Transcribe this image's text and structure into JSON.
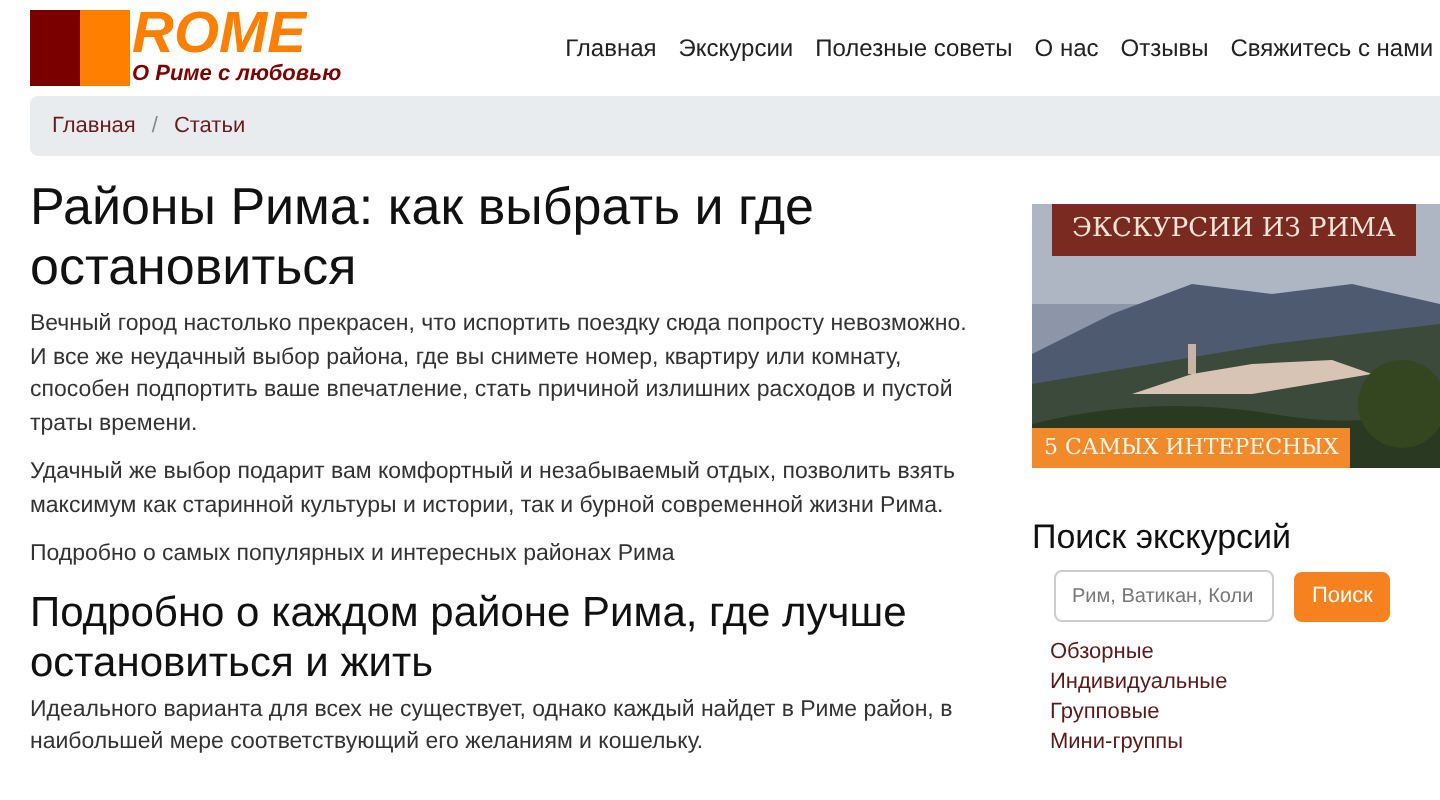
{
  "logo": {
    "title": "ROME",
    "tagline": "О Риме с любовью"
  },
  "nav": [
    "Главная",
    "Экскурсии",
    "Полезные советы",
    "О нас",
    "Отзывы",
    "Свяжитесь с нами"
  ],
  "breadcrumb": [
    "Главная",
    "Статьи"
  ],
  "breadcrumb_separator": "/",
  "article": {
    "title": "Районы Рима: как выбрать и где остановиться",
    "paragraphs": [
      "Вечный город настолько прекрасен, что испортить поездку сюда попросту невозможно. И все же неудачный выбор района, где вы снимете номер, квартиру или комнату, способен подпортить ваше впечатление, стать причиной излишних расходов и пустой траты времени.",
      "Удачный же выбор подарит вам комфортный и незабываемый отдых, позволить  взять максимум как старинной культуры и истории, так и бурной современной жизни Рима.",
      "Подробно о самых популярных и интересных районах Рима"
    ],
    "subtitle": "Подробно о каждом районе Рима, где лучше остановиться и жить",
    "subparagraph": "Идеального варианта для всех не существует, однако каждый найдет в Риме район, в наибольшей мере соответствующий его желаниям и кошельку."
  },
  "banner": {
    "kind": "picture",
    "title": "ЭКСКУРСИИ ИЗ РИМА",
    "caption": "5 САМЫХ ИНТЕРЕСНЫХ"
  },
  "search": {
    "title": "Поиск экскурсий",
    "placeholder": "Рим, Ватикан, Коли",
    "button": "Поиск"
  },
  "categories": [
    "Обзорные",
    "Индивидуальные",
    "Групповые",
    "Мини-группы"
  ]
}
